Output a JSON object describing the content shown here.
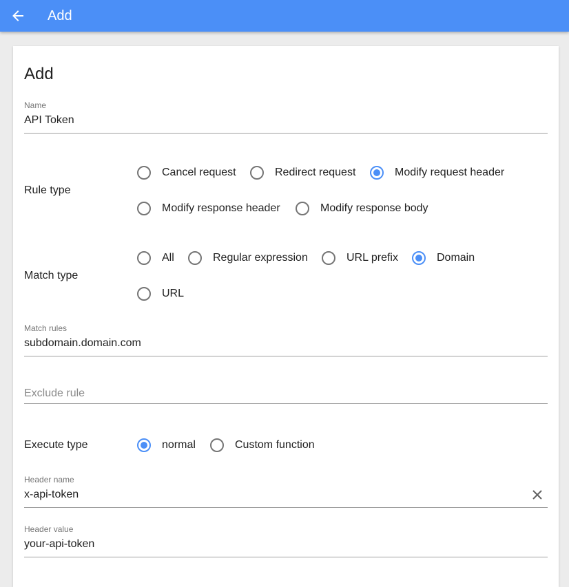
{
  "appbar": {
    "title": "Add",
    "back_icon": "arrow-back-icon"
  },
  "form": {
    "heading": "Add",
    "name": {
      "label": "Name",
      "value": "API Token"
    },
    "rule_type": {
      "label": "Rule type",
      "options": [
        "Cancel request",
        "Redirect request",
        "Modify request header",
        "Modify response header",
        "Modify response body"
      ],
      "selected": "Modify request header"
    },
    "match_type": {
      "label": "Match type",
      "options": [
        "All",
        "Regular expression",
        "URL prefix",
        "Domain",
        "URL"
      ],
      "selected": "Domain"
    },
    "match_rules": {
      "label": "Match rules",
      "value": "subdomain.domain.com"
    },
    "exclude_rule": {
      "placeholder": "Exclude rule",
      "value": ""
    },
    "execute_type": {
      "label": "Execute type",
      "options": [
        "normal",
        "Custom function"
      ],
      "selected": "normal"
    },
    "header_name": {
      "label": "Header name",
      "value": "x-api-token",
      "clear_icon": "close-icon"
    },
    "header_value": {
      "label": "Header value",
      "value": "your-api-token"
    }
  },
  "colors": {
    "accent": "#4b8ff7",
    "appbar": "#4b8ff7",
    "background": "#ececec"
  }
}
